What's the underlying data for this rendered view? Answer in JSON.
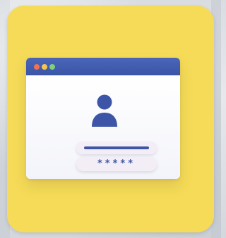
{
  "login_window": {
    "accent_color": "#3d55a6",
    "tile_color": "#f5db58",
    "titlebar_buttons": [
      "close",
      "minimize",
      "maximize"
    ],
    "avatar_icon": "user-avatar-icon",
    "password_field": {
      "value": "*****"
    }
  }
}
